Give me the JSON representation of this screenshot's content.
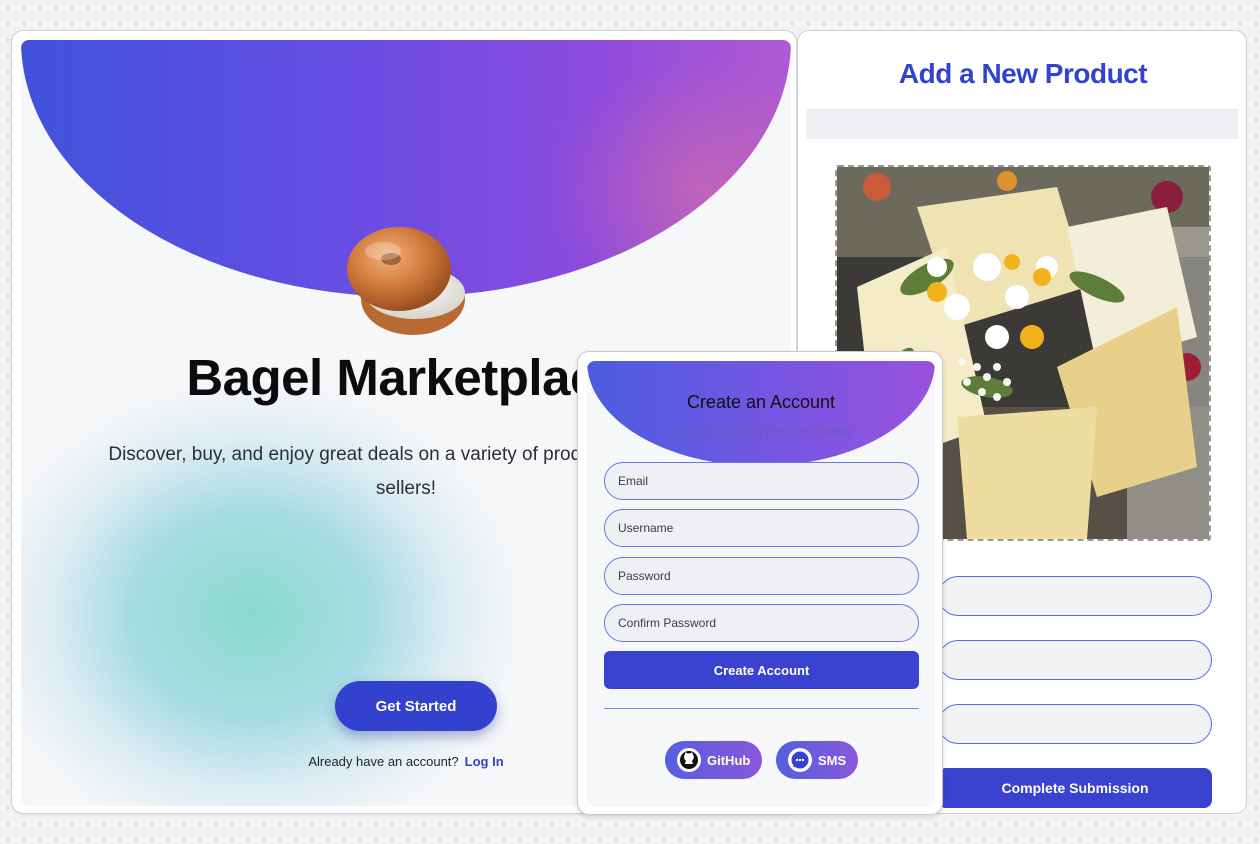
{
  "landing": {
    "title": "Bagel Marketplace",
    "tagline": "Discover, buy, and enjoy great deals on a variety of products from local sellers!",
    "cta_label": "Get Started",
    "login_prompt": "Already have an account?",
    "login_link": "Log In",
    "mascot_icon": "bagel-image"
  },
  "product_form": {
    "title": "Add a New Product",
    "photo": "flower-bouquet-photo",
    "fields": [
      "",
      "",
      ""
    ],
    "submit_label": "Complete Submission"
  },
  "signup": {
    "title": "Create an Account",
    "subtitle": "Join us by filling the form below",
    "email_placeholder": "Email",
    "username_placeholder": "Username",
    "password_placeholder": "Password",
    "confirm_placeholder": "Confirm Password",
    "create_label": "Create Account",
    "social": [
      {
        "label": "GitHub",
        "icon": "github-icon"
      },
      {
        "label": "SMS",
        "icon": "chat-bubble-icon"
      }
    ]
  },
  "colors": {
    "accent": "#3341cf",
    "hero_start": "#3f52db",
    "hero_end": "#b05ad2",
    "title_blue": "#3443cd"
  }
}
